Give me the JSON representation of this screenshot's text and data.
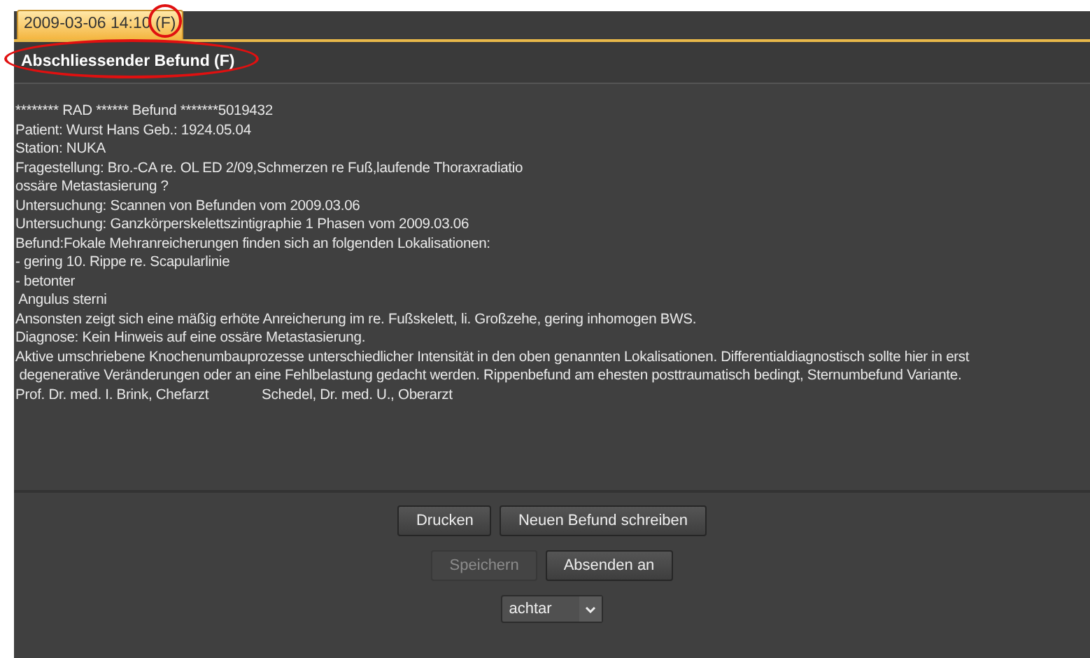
{
  "tabs": [
    {
      "label": "2009-03-06 14:10",
      "suffix": "(F)",
      "selected": true
    }
  ],
  "heading": "Abschliessender Befund (F)",
  "report_lines": [
    "******** RAD ****** Befund *******5019432",
    "Patient: Wurst Hans Geb.: 1924.05.04",
    "Station: NUKA",
    "Fragestellung: Bro.-CA re. OL ED 2/09,Schmerzen re Fuß,laufende Thoraxradiatio",
    "ossäre Metastasierung ?",
    "Untersuchung: Scannen von Befunden vom 2009.03.06",
    "Untersuchung: Ganzkörperskelettszintigraphie 1 Phasen vom 2009.03.06",
    "Befund:Fokale Mehranreicherungen finden sich an folgenden Lokalisationen:",
    "- gering 10. Rippe re. Scapularlinie",
    "- betonter",
    " Angulus sterni",
    "Ansonsten zeigt sich eine mäßig erhöte Anreicherung im re. Fußskelett, li. Großzehe, gering inhomogen BWS.",
    "Diagnose: Kein Hinweis auf eine ossäre Metastasierung.",
    "Aktive umschriebene Knochenumbauprozesse unterschiedlicher Intensität in den oben genannten Lokalisationen. Differentialdiagnostisch sollte hier in erst",
    " degenerative Veränderungen oder an eine Fehlbelastung gedacht werden. Rippenbefund am ehesten posttraumatisch bedingt, Sternumbefund Variante.",
    "Prof. Dr. med. I. Brink, Chefarzt              Schedel, Dr. med. U., Oberarzt"
  ],
  "button_rows": [
    [
      {
        "label": "Drucken",
        "disabled": false
      },
      {
        "label": "Neuen Befund schreiben",
        "disabled": false
      }
    ],
    [
      {
        "label": "Speichern",
        "disabled": true
      },
      {
        "label": "Absenden an",
        "disabled": false
      }
    ]
  ],
  "recipient_select": {
    "value": "achtar"
  }
}
